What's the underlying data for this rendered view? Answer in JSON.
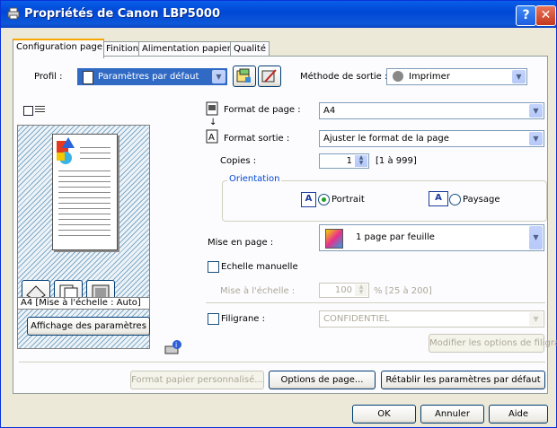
{
  "window": {
    "title": "Propriétés de Canon LBP5000",
    "help_label": "?",
    "close_label": "✕"
  },
  "tabs": [
    {
      "label": "Configuration page"
    },
    {
      "label": "Finition"
    },
    {
      "label": "Alimentation papier"
    },
    {
      "label": "Qualité"
    }
  ],
  "profile": {
    "label": "Profil :",
    "value": "Paramètres par défaut"
  },
  "output": {
    "label": "Méthode de sortie :",
    "value": "Imprimer"
  },
  "preview": {
    "caption": "A4 [Mise à l'échelle : Auto]",
    "settings_button": "Affichage des paramètres"
  },
  "page_format": {
    "label": "Format de page :",
    "value": "A4"
  },
  "output_format": {
    "label": "Format sortie :",
    "value": "Ajuster le format de la page"
  },
  "copies": {
    "label": "Copies :",
    "value": "1",
    "range": "[1 à 999]"
  },
  "orientation": {
    "group_label": "Orientation",
    "portrait": "Portrait",
    "landscape": "Paysage",
    "icon_letter": "A"
  },
  "layout": {
    "label": "Mise en page :",
    "value": "1 page par feuille"
  },
  "manual_scale": {
    "label": "Echelle manuelle"
  },
  "scale": {
    "label": "Mise à l'échelle :",
    "value": "100",
    "range": "% [25 à 200]"
  },
  "watermark": {
    "label": "Filigrane :",
    "value": "CONFIDENTIEL",
    "edit_button": "Modifier les options de filigrane..."
  },
  "bottom": {
    "custom_paper": "Format papier personnalisé...",
    "page_options": "Options de page...",
    "restore_defaults": "Rétablir les paramètres par défaut"
  },
  "dialog": {
    "ok": "OK",
    "cancel": "Annuler",
    "help": "Aide"
  }
}
